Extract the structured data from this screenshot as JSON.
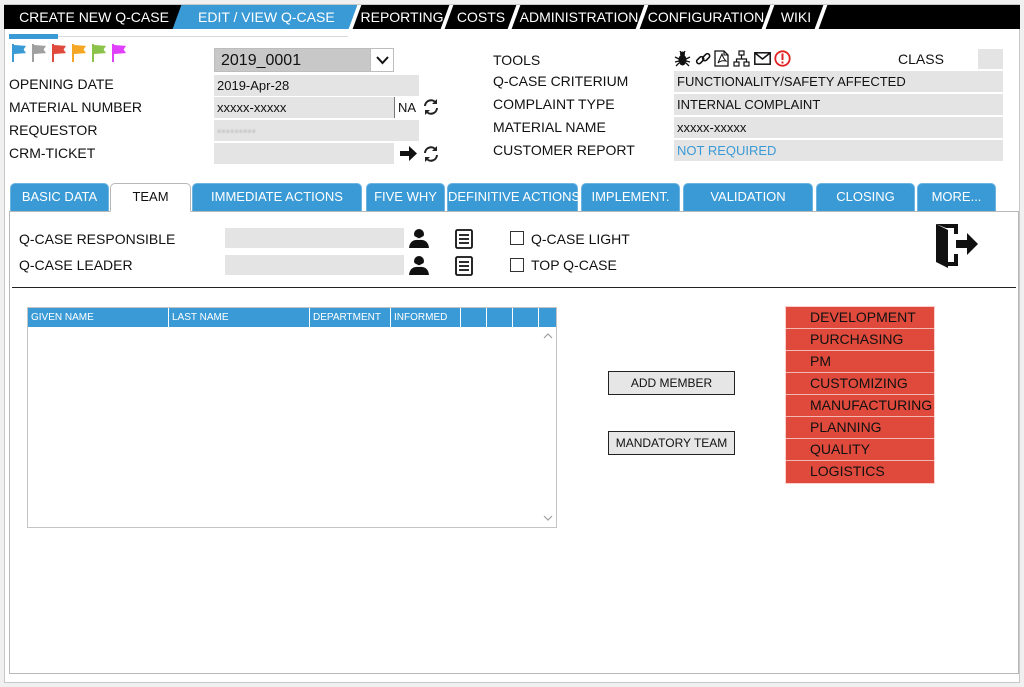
{
  "nav": {
    "items": [
      "CREATE NEW Q-CASE",
      "EDIT / VIEW Q-CASE",
      "REPORTING",
      "COSTS",
      "ADMINISTRATION",
      "CONFIGURATION",
      "WIKI"
    ],
    "active": "EDIT / VIEW Q-CASE"
  },
  "flags": [
    "#3a9ad6",
    "#a0a0a0",
    "#e04a3c",
    "#f5a623",
    "#8bc34a",
    "#e040fb"
  ],
  "header": {
    "case_id": "2019_0001",
    "opening_date_label": "OPENING DATE",
    "opening_date": "2019-Apr-28",
    "material_number_label": "MATERIAL NUMBER",
    "material_number": "xxxxx-xxxxx",
    "material_suffix": "NA",
    "requestor_label": "REQUESTOR",
    "requestor": "·········",
    "crm_ticket_label": "CRM-TICKET",
    "crm_ticket": "",
    "tools_label": "TOOLS",
    "class_label": "CLASS",
    "class_value": "",
    "criterium_label": "Q-CASE CRITERIUM",
    "criterium": "FUNCTIONALITY/SAFETY AFFECTED",
    "complaint_type_label": "COMPLAINT TYPE",
    "complaint_type": "INTERNAL COMPLAINT",
    "material_name_label": "MATERIAL NAME",
    "material_name": "xxxxx-xxxxx",
    "customer_report_label": "CUSTOMER REPORT",
    "customer_report": "NOT REQUIRED"
  },
  "tabs": [
    "BASIC DATA",
    "TEAM",
    "IMMEDIATE ACTIONS",
    "FIVE WHY",
    "DEFINITIVE ACTIONS",
    "IMPLEMENT.",
    "VALIDATION",
    "CLOSING",
    "MORE..."
  ],
  "active_tab": "TEAM",
  "team": {
    "responsible_label": "Q-CASE RESPONSIBLE",
    "responsible": "",
    "leader_label": "Q-CASE LEADER",
    "leader": "",
    "light_label": "Q-CASE LIGHT",
    "light_checked": false,
    "top_label": "TOP Q-CASE",
    "top_checked": false,
    "columns": [
      "GIVEN NAME",
      "LAST NAME",
      "DEPARTMENT",
      "INFORMED",
      "",
      "",
      "",
      ""
    ],
    "rows": [],
    "add_member_label": "ADD MEMBER",
    "mandatory_team_label": "MANDATORY TEAM",
    "departments": [
      "DEVELOPMENT",
      "PURCHASING",
      "PM",
      "CUSTOMIZING",
      "MANUFACTURING",
      "PLANNING",
      "QUALITY",
      "LOGISTICS"
    ]
  },
  "colors": {
    "accent": "#3a9ad6",
    "dept": "#e04a3c",
    "link": "#3a9ad6"
  }
}
